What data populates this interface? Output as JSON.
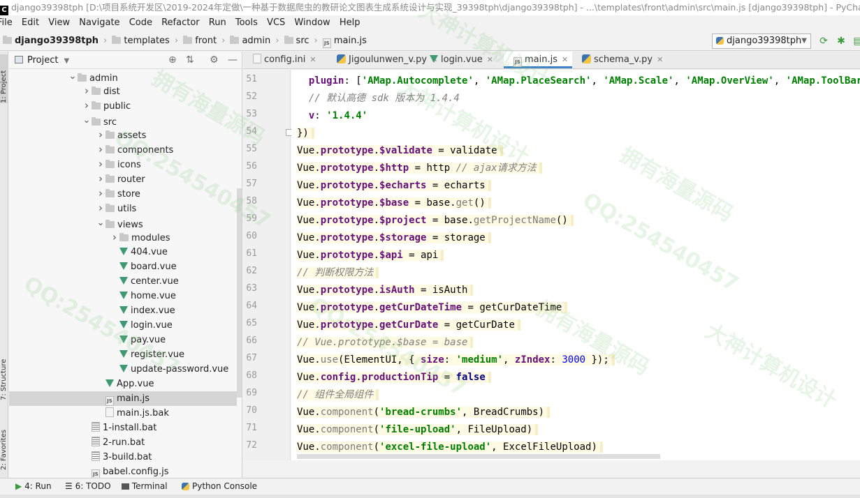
{
  "titlebar": {
    "text": "django39398tph [D:\\项目系统开发区\\2019-2024年定做\\一种基于数据爬虫的教研论文图表生成系统设计与实现_39398tph\\django39398tph] - ...\\templates\\front\\admin\\src\\main.js [django39398tph] - PyCharm (Adm..."
  },
  "menu": [
    "File",
    "Edit",
    "View",
    "Navigate",
    "Code",
    "Refactor",
    "Run",
    "Tools",
    "VCS",
    "Window",
    "Help"
  ],
  "breadcrumb": {
    "project": "django39398tph",
    "items": [
      "templates",
      "front",
      "admin",
      "src"
    ],
    "file": "main.js"
  },
  "run_config": "django39398tph",
  "project_panel": {
    "title": "Project",
    "tree": [
      {
        "label": "admin",
        "level": 0,
        "arrow": "down",
        "icon": "folder"
      },
      {
        "label": "dist",
        "level": 1,
        "arrow": "right",
        "icon": "folder"
      },
      {
        "label": "public",
        "level": 1,
        "arrow": "right",
        "icon": "folder"
      },
      {
        "label": "src",
        "level": 1,
        "arrow": "down",
        "icon": "folder"
      },
      {
        "label": "assets",
        "level": 2,
        "arrow": "right",
        "icon": "folder"
      },
      {
        "label": "components",
        "level": 2,
        "arrow": "right",
        "icon": "folder"
      },
      {
        "label": "icons",
        "level": 2,
        "arrow": "right",
        "icon": "folder"
      },
      {
        "label": "router",
        "level": 2,
        "arrow": "right",
        "icon": "folder"
      },
      {
        "label": "store",
        "level": 2,
        "arrow": "right",
        "icon": "folder"
      },
      {
        "label": "utils",
        "level": 2,
        "arrow": "right",
        "icon": "folder"
      },
      {
        "label": "views",
        "level": 2,
        "arrow": "down",
        "icon": "folder"
      },
      {
        "label": "modules",
        "level": 3,
        "arrow": "right",
        "icon": "folder"
      },
      {
        "label": "404.vue",
        "level": 3,
        "arrow": "",
        "icon": "vue"
      },
      {
        "label": "board.vue",
        "level": 3,
        "arrow": "",
        "icon": "vue"
      },
      {
        "label": "center.vue",
        "level": 3,
        "arrow": "",
        "icon": "vue"
      },
      {
        "label": "home.vue",
        "level": 3,
        "arrow": "",
        "icon": "vue"
      },
      {
        "label": "index.vue",
        "level": 3,
        "arrow": "",
        "icon": "vue"
      },
      {
        "label": "login.vue",
        "level": 3,
        "arrow": "",
        "icon": "vue"
      },
      {
        "label": "pay.vue",
        "level": 3,
        "arrow": "",
        "icon": "vue"
      },
      {
        "label": "register.vue",
        "level": 3,
        "arrow": "",
        "icon": "vue"
      },
      {
        "label": "update-password.vue",
        "level": 3,
        "arrow": "",
        "icon": "vue"
      },
      {
        "label": "App.vue",
        "level": 2,
        "arrow": "",
        "icon": "vue"
      },
      {
        "label": "main.js",
        "level": 2,
        "arrow": "",
        "icon": "js",
        "selected": true
      },
      {
        "label": "main.js.bak",
        "level": 2,
        "arrow": "",
        "icon": "file"
      },
      {
        "label": "1-install.bat",
        "level": 1,
        "arrow": "",
        "icon": "bat"
      },
      {
        "label": "2-run.bat",
        "level": 1,
        "arrow": "",
        "icon": "bat"
      },
      {
        "label": "3-build.bat",
        "level": 1,
        "arrow": "",
        "icon": "bat"
      },
      {
        "label": "babel.config.js",
        "level": 1,
        "arrow": "",
        "icon": "js"
      }
    ]
  },
  "editor_tabs": [
    {
      "label": "config.ini",
      "icon": "ini",
      "active": false
    },
    {
      "label": "Jigoulunwen_v.py",
      "icon": "py",
      "active": false
    },
    {
      "label": "login.vue",
      "icon": "vue",
      "active": false
    },
    {
      "label": "main.js",
      "icon": "js",
      "active": true
    },
    {
      "label": "schema_v.py",
      "icon": "py",
      "active": false
    }
  ],
  "line_numbers": [
    "51",
    "52",
    "53",
    "54",
    "55",
    "56",
    "57",
    "58",
    "59",
    "60",
    "61",
    "62",
    "63",
    "64",
    "65",
    "66",
    "67",
    "68",
    "69",
    "70",
    "71",
    "72"
  ],
  "code_lines": [
    "  plugin: ['AMap.Autocomplete', 'AMap.PlaceSearch', 'AMap.Scale', 'AMap.OverView', 'AMap.ToolBar', 'A",
    "  // 默认高德 sdk 版本为 1.4.4",
    "  v: '1.4.4'",
    "})",
    "Vue.prototype.$validate = validate",
    "Vue.prototype.$http = http // ajax请求方法",
    "Vue.prototype.$echarts = echarts",
    "Vue.prototype.$base = base.get()",
    "Vue.prototype.$project = base.getProjectName()",
    "Vue.prototype.$storage = storage",
    "Vue.prototype.$api = api",
    "// 判断权限方法",
    "Vue.prototype.isAuth = isAuth",
    "Vue.prototype.getCurDateTime = getCurDateTime",
    "Vue.prototype.getCurDate = getCurDate",
    "// Vue.prototype.$base = base",
    "Vue.use(ElementUI, { size: 'medium', zIndex: 3000 });",
    "Vue.config.productionTip = false",
    "// 组件全局组件",
    "Vue.component('bread-crumbs', BreadCrumbs)",
    "Vue.component('file-upload', FileUpload)",
    "Vue.component('excel-file-upload', ExcelFileUpload)"
  ],
  "left_stripe": {
    "project_tab": "1: Project",
    "structure_tab": "7: Structure",
    "favorites_tab": "2: Favorites"
  },
  "bottom_tools": [
    {
      "label": "4: Run",
      "icon": "play-icon"
    },
    {
      "label": "6: TODO",
      "icon": "list-icon"
    },
    {
      "label": "Terminal",
      "icon": "terminal-icon"
    },
    {
      "label": "Python Console",
      "icon": "python-icon"
    }
  ],
  "watermarks": [
    "拥有海量源码",
    "QQ:254540457",
    "大神计算机设计"
  ]
}
